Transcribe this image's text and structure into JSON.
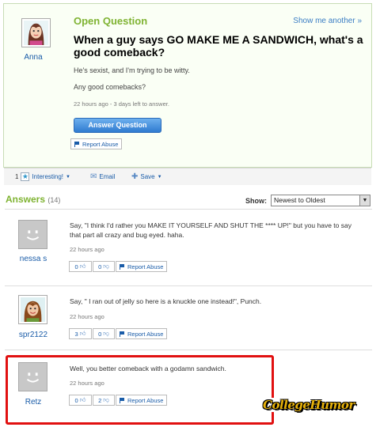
{
  "question": {
    "label": "Open Question",
    "show_another": "Show me another »",
    "user": "Anna",
    "title": "When a guy says GO MAKE ME A SANDWICH, what's a good comeback?",
    "body1": "He's sexist, and I'm trying to be witty.",
    "body2": "Any good comebacks?",
    "meta": "22 hours ago - 3 days left to answer.",
    "answer_button": "Answer Question",
    "report": "Report Abuse"
  },
  "toolbar": {
    "interesting_count": "1",
    "interesting": "Interesting!",
    "email": "Email",
    "save": "Save"
  },
  "answers_header": {
    "title": "Answers",
    "count": "(14)",
    "show_label": "Show:",
    "sort_value": "Newest to Oldest"
  },
  "answers": [
    {
      "user": "nessa s",
      "text": "Say, \"I think I'd rather you MAKE IT YOURSELF AND SHUT THE **** UP!\" but you have to say that part all crazy and bug eyed. haha.",
      "time": "22 hours ago",
      "up": "0",
      "down": "0",
      "report": "Report Abuse"
    },
    {
      "user": "spr2122",
      "text": "Say, \" I ran out of jelly so here is a knuckle one instead!\", Punch.",
      "time": "22 hours ago",
      "up": "3",
      "down": "0",
      "report": "Report Abuse"
    },
    {
      "user": "Retz",
      "text": "Well, you better comeback with a godamn sandwich.",
      "time": "22 hours ago",
      "up": "0",
      "down": "2",
      "report": "Report Abuse"
    }
  ],
  "watermark": "CollegeHumor",
  "colors": {
    "accent_green": "#7fb332",
    "link_blue": "#1a5ca8",
    "highlight_red": "#e11010"
  }
}
